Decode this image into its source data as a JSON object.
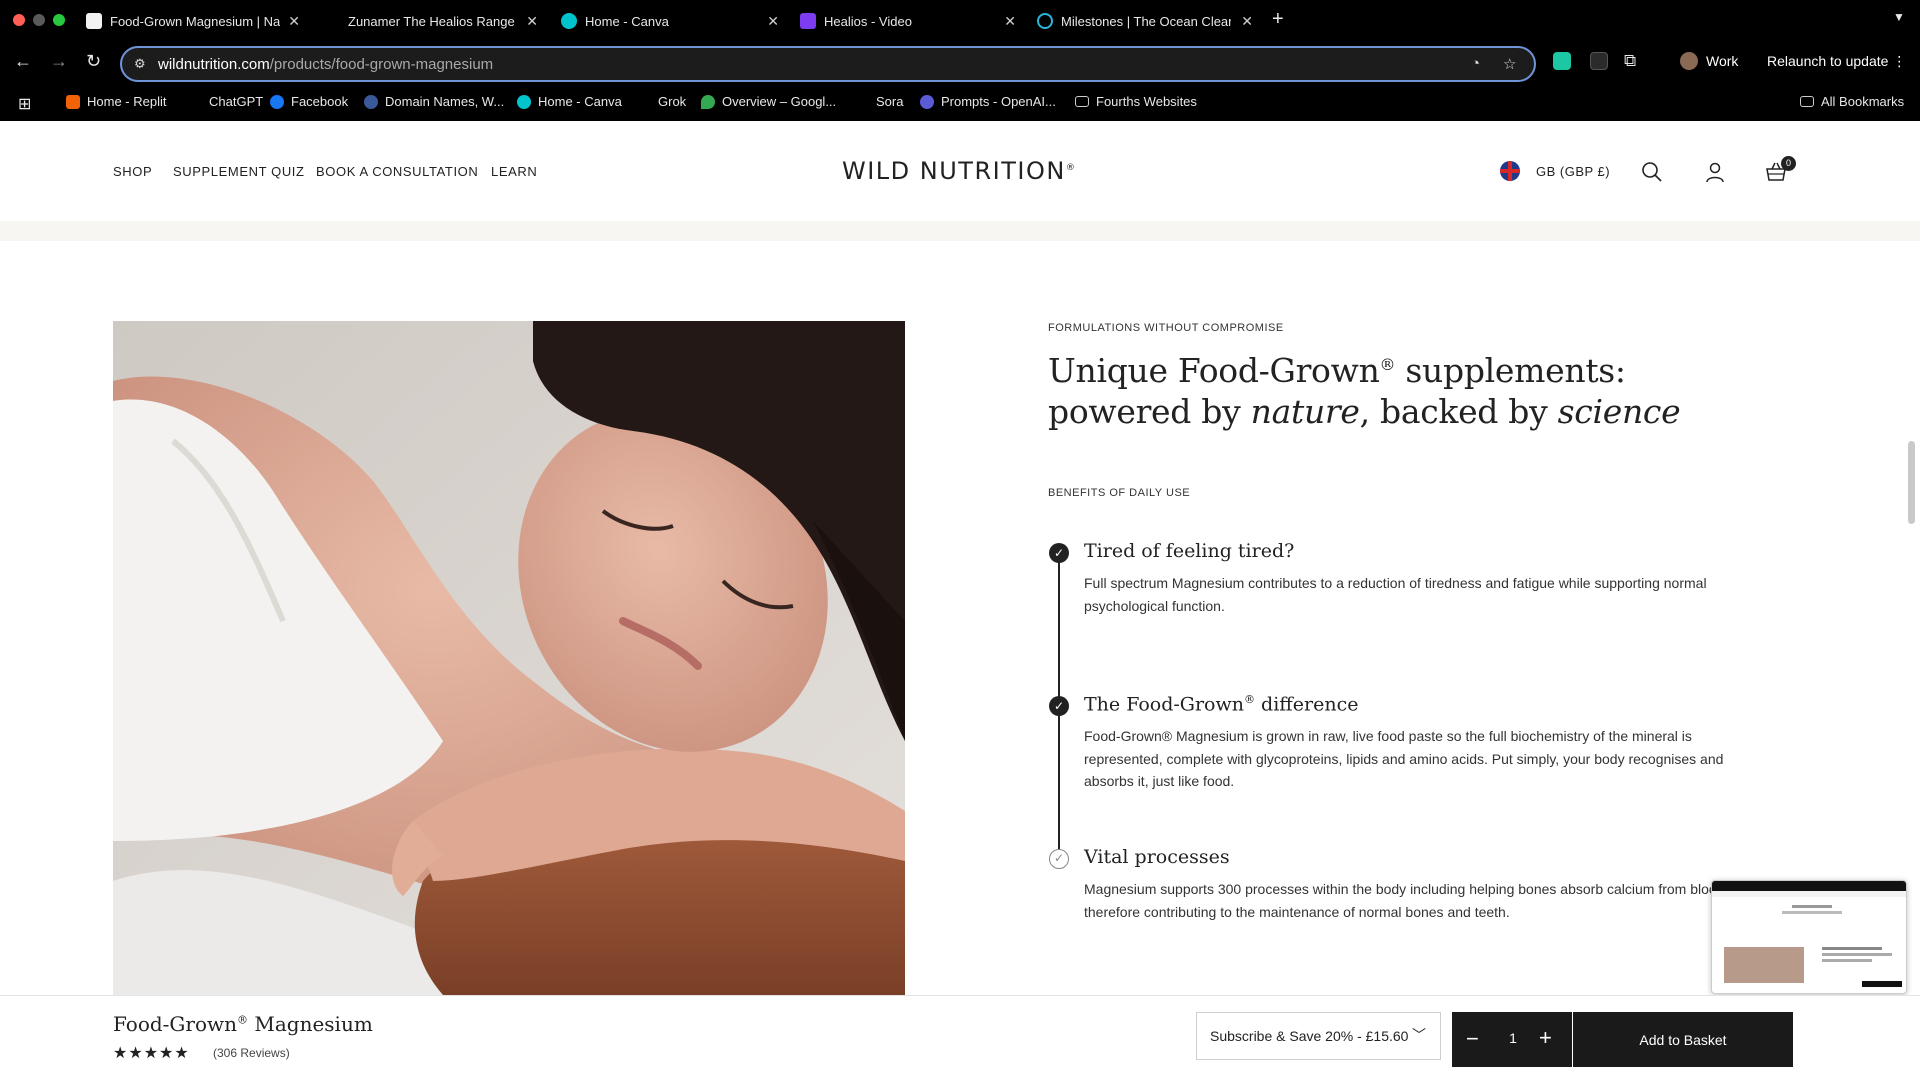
{
  "browser": {
    "tabs": [
      {
        "title": "Food-Grown Magnesium | Nat",
        "icon": "wild-nutrition-favicon"
      },
      {
        "title": "Zunamer The Healios Range",
        "icon": "blank-favicon"
      },
      {
        "title": "Home - Canva",
        "icon": "canva-favicon"
      },
      {
        "title": "Healios - Video",
        "icon": "video-favicon"
      },
      {
        "title": "Milestones | The Ocean Clean",
        "icon": "ocean-cleanup-favicon"
      }
    ],
    "url_host": "wildnutrition.com",
    "url_path": "/products/food-grown-magnesium",
    "profile_name": "Work",
    "relaunch_label": "Relaunch to update",
    "bookmarks": [
      {
        "label": "Home - Replit",
        "color": "#f26207"
      },
      {
        "label": "ChatGPT",
        "color": "#000000"
      },
      {
        "label": "Facebook",
        "color": "#1877f2"
      },
      {
        "label": "Domain Names, W...",
        "color": "#3b5998"
      },
      {
        "label": "Home - Canva",
        "color": "#00c4cc"
      },
      {
        "label": "Grok",
        "color": "#000000"
      },
      {
        "label": "Overview – Googl...",
        "color": "#34a853"
      },
      {
        "label": "Sora",
        "color": "#000000"
      },
      {
        "label": "Prompts - OpenAI...",
        "color": "#5b5bd6"
      },
      {
        "label": "Fourths Websites",
        "color": "#000000"
      }
    ],
    "all_bookmarks_label": "All Bookmarks"
  },
  "site": {
    "nav": [
      "SHOP",
      "SUPPLEMENT QUIZ",
      "BOOK A CONSULTATION",
      "LEARN"
    ],
    "logo": "WILD NUTRITION",
    "logo_mark": "®",
    "currency": "GB (GBP £)",
    "cart_count": "0"
  },
  "content": {
    "eyebrow": "FORMULATIONS WITHOUT COMPROMISE",
    "headline_part1": "Unique Food-Grown",
    "headline_reg": "®",
    "headline_part2": " supplements: powered by ",
    "headline_em1": "nature",
    "headline_part3": ", backed by ",
    "headline_em2": "science",
    "benefits_label": "BENEFITS OF DAILY USE",
    "benefits": [
      {
        "title": "Tired of feeling tired?",
        "body": "Full spectrum Magnesium contributes to a reduction of tiredness and fatigue while supporting normal psychological function.",
        "checked": true
      },
      {
        "title": "The Food-Grown",
        "title_reg": "®",
        "title_tail": " difference",
        "body": "Food-Grown® Magnesium is grown in raw, live food paste so the full biochemistry of the mineral is represented, complete with glycoproteins, lipids and amino acids. Put simply, your body recognises and absorbs it, just like food.",
        "checked": true
      },
      {
        "title": "Vital processes",
        "body": "Magnesium supports 300 processes within the body including helping bones absorb calcium from blood, therefore contributing to the maintenance of normal bones and teeth.",
        "checked": false
      }
    ]
  },
  "sticky": {
    "product_name": "Food-Grown",
    "product_reg": "®",
    "product_tail": " Magnesium",
    "stars": "★★★★★",
    "rating": 4.5,
    "reviews": "(306 Reviews)",
    "subscription_option": "Subscribe & Save 20% - £15.60",
    "quantity": "1",
    "add_label": "Add to Basket"
  },
  "colors": {
    "accent": "#1a1a1a",
    "band": "#f7f6f2",
    "omnibox_focus": "#6f95d8"
  }
}
